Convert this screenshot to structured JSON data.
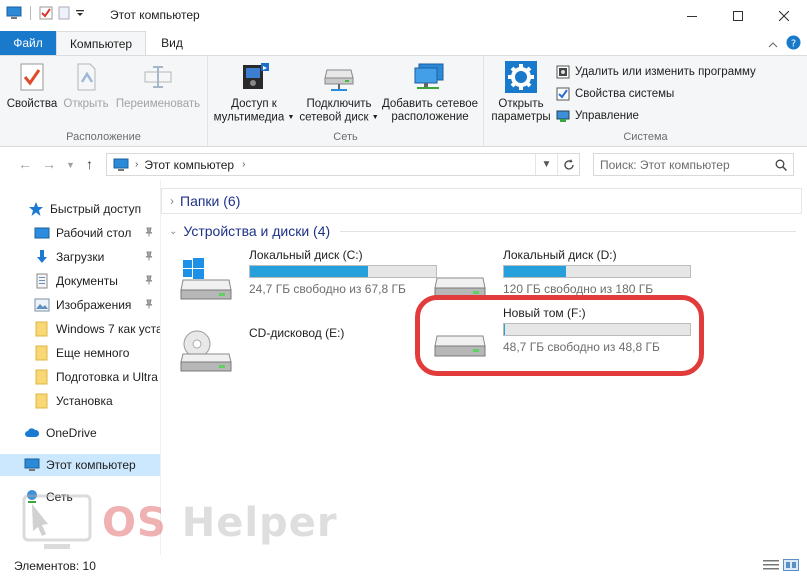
{
  "window": {
    "title": "Этот компьютер"
  },
  "tabs": {
    "file": "Файл",
    "computer": "Компьютер",
    "view": "Вид"
  },
  "ribbon": {
    "location": {
      "label": "Расположение",
      "properties": "Свойства",
      "open": "Открыть",
      "rename": "Переименовать"
    },
    "network": {
      "label": "Сеть",
      "media_line1": "Доступ к",
      "media_line2": "мультимедиа",
      "map_line1": "Подключить",
      "map_line2": "сетевой диск",
      "add_line1": "Добавить сетевое",
      "add_line2": "расположение"
    },
    "system": {
      "label": "Система",
      "settings_line1": "Открыть",
      "settings_line2": "параметры",
      "uninstall": "Удалить или изменить программу",
      "sysprops": "Свойства системы",
      "manage": "Управление"
    }
  },
  "address": {
    "path": "Этот компьютер",
    "search_placeholder": "Поиск: Этот компьютер"
  },
  "sidebar": {
    "quick_access": "Быстрый доступ",
    "items": [
      {
        "label": "Рабочий стол",
        "pinned": true
      },
      {
        "label": "Загрузки",
        "pinned": true
      },
      {
        "label": "Документы",
        "pinned": true
      },
      {
        "label": "Изображения",
        "pinned": true
      },
      {
        "label": "Windows 7 как уста",
        "pinned": false
      },
      {
        "label": "Еще немного",
        "pinned": false
      },
      {
        "label": "Подготовка и Ultra",
        "pinned": false
      },
      {
        "label": "Установка",
        "pinned": false
      }
    ],
    "onedrive": "OneDrive",
    "this_pc": "Этот компьютер",
    "network": "Сеть"
  },
  "content": {
    "folders_group": "Папки (6)",
    "devices_group": "Устройства и диски (4)",
    "drives": [
      {
        "name": "Локальный диск (C:)",
        "free": "24,7 ГБ свободно из 67,8 ГБ",
        "used_fraction": 0.636
      },
      {
        "name": "Локальный диск (D:)",
        "free": "120 ГБ свободно из 180 ГБ",
        "used_fraction": 0.333
      },
      {
        "name": "CD-дисковод (E:)",
        "free": "",
        "used_fraction": null
      },
      {
        "name": "Новый том (F:)",
        "free": "48,7 ГБ свободно из 48,8 ГБ",
        "used_fraction": 0.002
      }
    ]
  },
  "watermark": {
    "brand_a": "OS",
    "brand_b": " Helper"
  },
  "status": {
    "items": "Элементов: 10"
  },
  "colors": {
    "accent": "#1979ca",
    "bar_fill": "#26a0da",
    "highlight": "#e23b3b",
    "selection": "#cce8ff"
  }
}
